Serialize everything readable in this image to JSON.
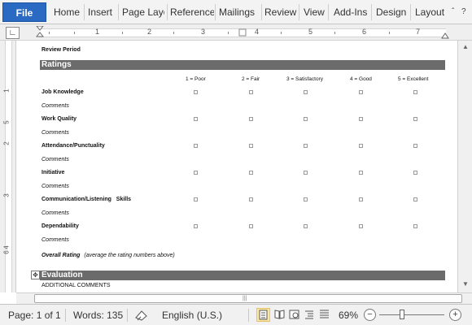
{
  "ribbon": {
    "file_label": "File",
    "tabs": [
      "Home",
      "Insert",
      "Page Layo",
      "Reference",
      "Mailings",
      "Review",
      "View",
      "Add-Ins",
      "Design",
      "Layout"
    ],
    "minimize_glyph": "ˆ",
    "help_glyph": "?"
  },
  "ruler": {
    "tab_selector_glyph": "∟",
    "numbers": [
      "1",
      "2",
      "3",
      "4",
      "5",
      "6",
      "7"
    ]
  },
  "vruler": {
    "numbers": [
      "1",
      "2",
      "3",
      "4",
      "5",
      "6"
    ]
  },
  "document": {
    "review_period": "Review Period",
    "ratings_header": "Ratings",
    "columns": [
      "1 = Poor",
      "2 = Fair",
      "3 = Satisfactory",
      "4 = Good",
      "5 = Excellent"
    ],
    "criteria": [
      {
        "label": "Job Knowledge",
        "comments": "Comments"
      },
      {
        "label": "Work Quality",
        "comments": "Comments"
      },
      {
        "label": "Attendance/Punctuality",
        "comments": "Comments"
      },
      {
        "label": "Initiative",
        "comments": "Comments"
      },
      {
        "label": "Communication/Listening   Skills",
        "comments": "Comments"
      },
      {
        "label": "Dependability",
        "comments": "Comments"
      }
    ],
    "overall_rating_label": "Overall Rating",
    "overall_rating_note": "(average the rating numbers above)",
    "evaluation_header": "Evaluation",
    "additional_comments": "ADDITIONAL COMMENTS",
    "table_move_glyph": "✥"
  },
  "scrollbar": {
    "up_glyph": "▲",
    "down_glyph": "▼",
    "grip": "|||"
  },
  "status": {
    "page": "Page: 1 of 1",
    "words": "Words: 135",
    "language": "English (U.S.)",
    "zoom_level": "69%",
    "zoom_out": "−",
    "zoom_in": "+",
    "zoom_fraction": 0.35
  },
  "colors": {
    "file_button": "#2a6ac2",
    "section_bar": "#6b6b6b",
    "active_view": "#fbe7a3"
  }
}
